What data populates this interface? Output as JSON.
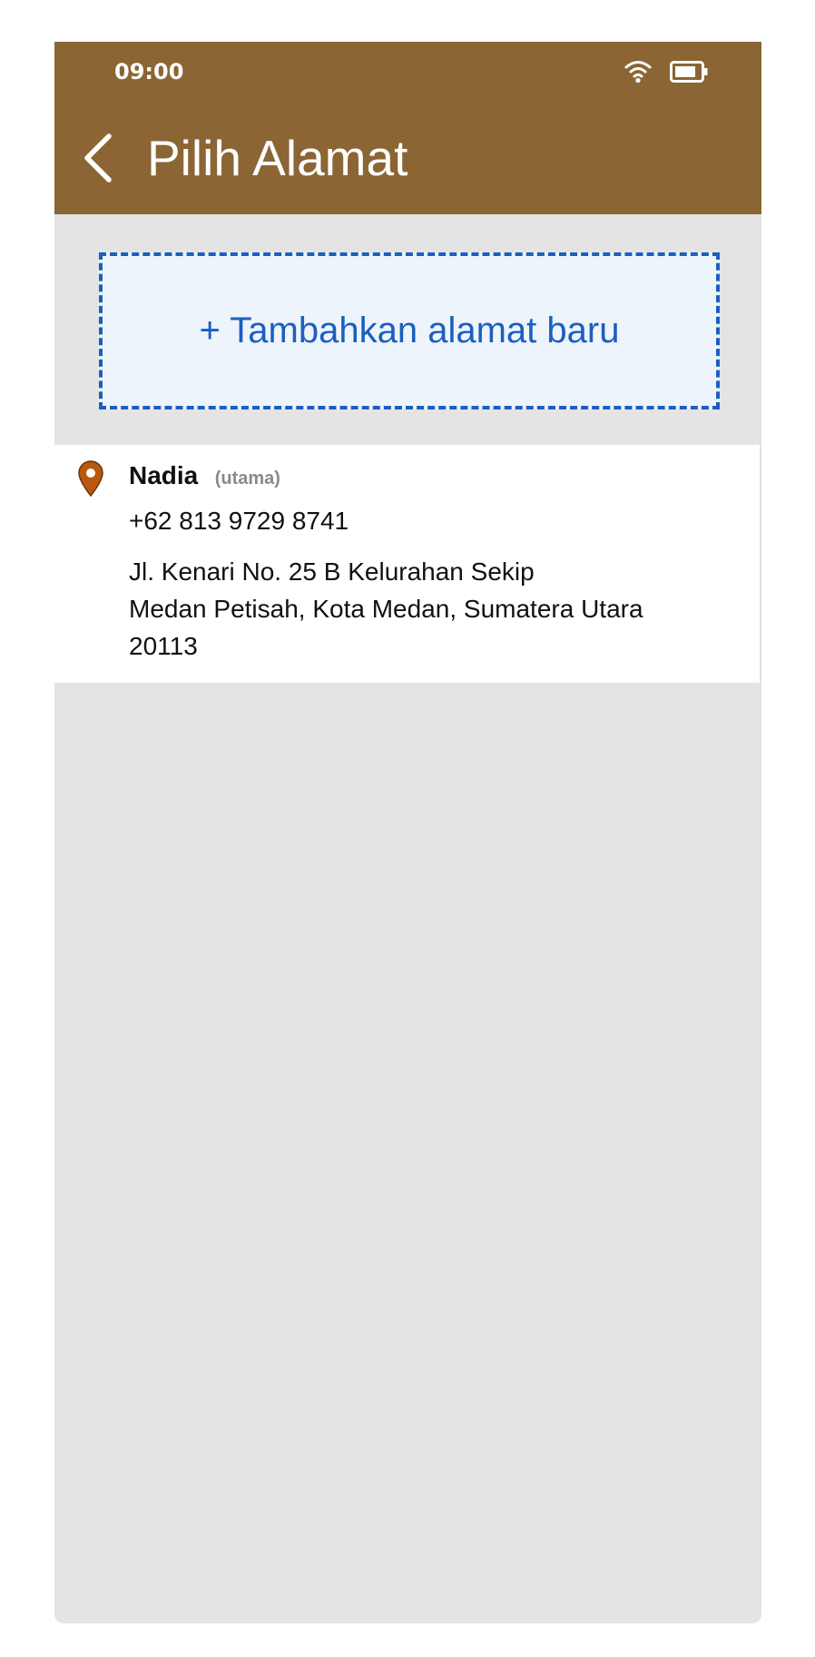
{
  "status_bar": {
    "time": "09:00",
    "icons": [
      "wifi-icon",
      "battery-icon"
    ]
  },
  "header": {
    "back_icon": "chevron-left-icon",
    "title": "Pilih Alamat"
  },
  "add_address": {
    "label": "+ Tambahkan alamat baru"
  },
  "addresses": [
    {
      "name": "Nadia",
      "badge": "(utama)",
      "phone": "+62 813 9729 8741",
      "lines": [
        "Jl. Kenari No. 25 B Kelurahan Sekip",
        "Medan Petisah, Kota Medan, Sumatera Utara",
        "20113"
      ],
      "icon": "location-pin-icon"
    }
  ],
  "colors": {
    "header_bg": "#8b6534",
    "accent_blue": "#1b5fbf",
    "add_bg": "#eef4fb",
    "pin": "#b8590f",
    "page_bg": "#e4e4e4"
  }
}
